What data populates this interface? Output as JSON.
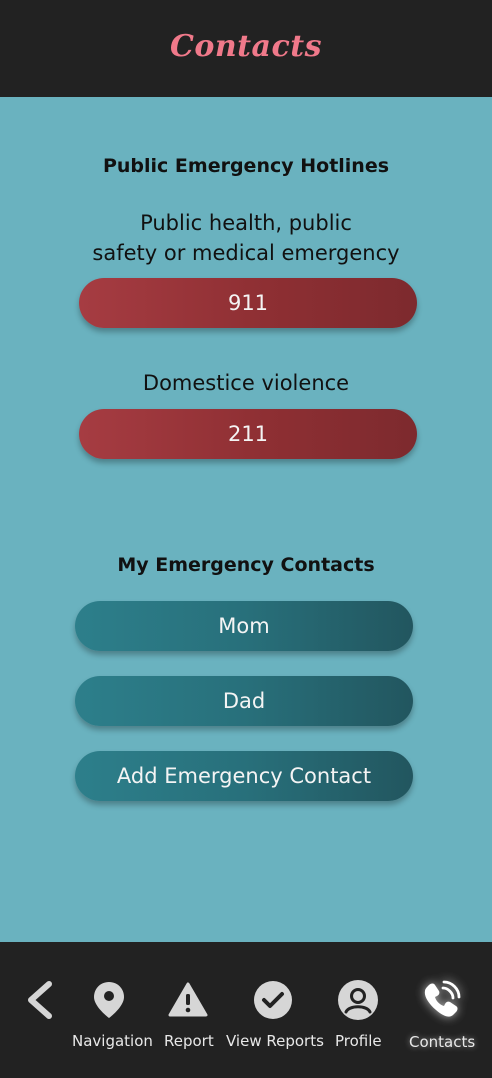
{
  "header": {
    "title": "Contacts"
  },
  "hotlines": {
    "section_title": "Public Emergency Hotlines",
    "items": [
      {
        "caption_line1": "Public health, public",
        "caption_line2": "safety or medical emergency",
        "number": "911"
      },
      {
        "caption_line1": "Domestice violence",
        "number": "211"
      }
    ]
  },
  "contacts": {
    "section_title": "My Emergency Contacts",
    "items": [
      {
        "label": "Mom"
      },
      {
        "label": "Dad"
      }
    ],
    "add_label": "Add Emergency Contact"
  },
  "navbar": {
    "items": [
      {
        "label": "",
        "icon": "back-chevron-icon"
      },
      {
        "label": "Navigation",
        "icon": "map-pin-icon"
      },
      {
        "label": "Report",
        "icon": "warning-icon"
      },
      {
        "label": "View Reports",
        "icon": "check-circle-icon"
      },
      {
        "label": "Profile",
        "icon": "user-circle-icon"
      },
      {
        "label": "Contacts",
        "icon": "phone-call-icon"
      }
    ],
    "active": "Contacts"
  },
  "colors": {
    "header_bg": "#222222",
    "title_pink": "#f0798a",
    "main_bg": "#6ab2bf",
    "hotline_red": "#9a363b",
    "contact_teal": "#2a7480"
  }
}
